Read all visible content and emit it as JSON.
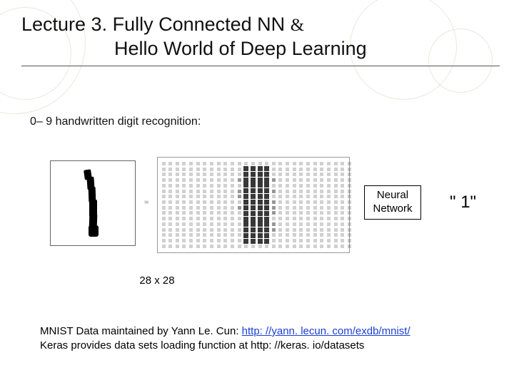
{
  "title": {
    "line1_prefix": "Lecture 3. Fully Connected NN ",
    "amp": "&",
    "line2": "Hello World of Deep Learning"
  },
  "sub_heading": "0– 9 handwritten digit recognition:",
  "approx_symbol": "≈",
  "nn_box_label": "Neural Network",
  "output_label": "\" 1\"",
  "size_caption": "28 x 28",
  "footer": {
    "line1_prefix": "MNIST Data maintained by Yann Le. Cun: ",
    "link_text": "http: //yann. lecun. com/exdb/mnist/",
    "line2": "Keras provides data sets loading function at http: //keras. io/datasets"
  }
}
